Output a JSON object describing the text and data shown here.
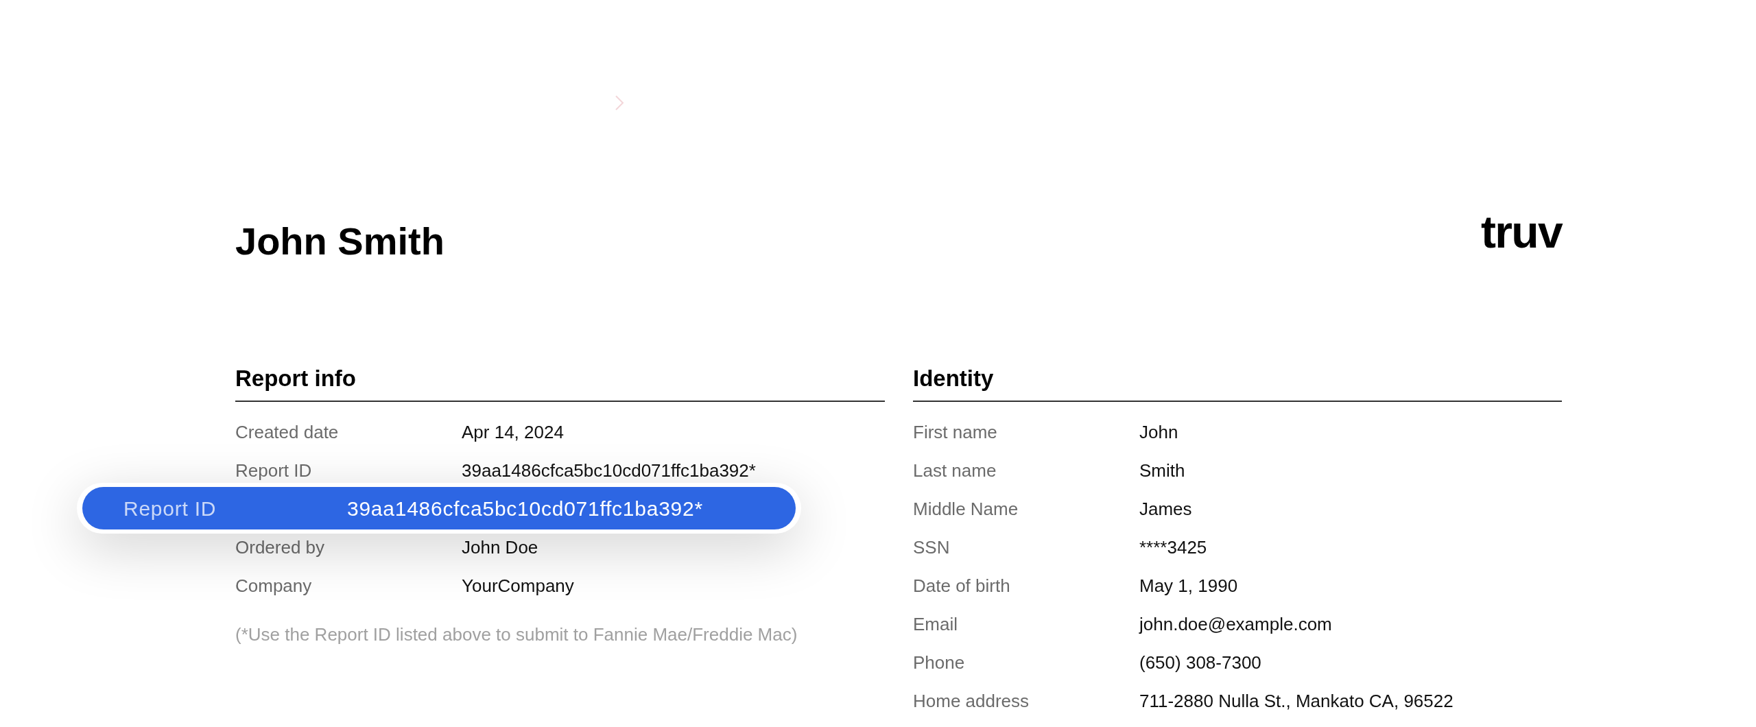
{
  "header": {
    "name": "John Smith",
    "logo": "truv"
  },
  "report_info": {
    "title": "Report info",
    "rows": [
      {
        "label": "Created date",
        "value": "Apr 14, 2024"
      },
      {
        "label": "Report ID",
        "value": "39aa1486cfca5bc10cd071ffc1ba392*"
      },
      {
        "label": "",
        "value": ""
      },
      {
        "label": "Ordered by",
        "value": "John Doe"
      },
      {
        "label": "Company",
        "value": "YourCompany"
      }
    ],
    "note": "(*Use the Report ID listed above to submit to Fannie Mae/Freddie Mac)"
  },
  "highlight": {
    "label": "Report ID",
    "value": "39aa1486cfca5bc10cd071ffc1ba392*"
  },
  "identity": {
    "title": "Identity",
    "rows": [
      {
        "label": "First name",
        "value": "John"
      },
      {
        "label": "Last name",
        "value": "Smith"
      },
      {
        "label": "Middle Name",
        "value": "James"
      },
      {
        "label": "SSN",
        "value": "****3425"
      },
      {
        "label": "Date of birth",
        "value": "May 1, 1990"
      },
      {
        "label": "Email",
        "value": "john.doe@example.com"
      },
      {
        "label": "Phone",
        "value": "(650) 308-7300"
      },
      {
        "label": "Home address",
        "value": "711-2880 Nulla St., Mankato CA, 96522"
      }
    ]
  }
}
